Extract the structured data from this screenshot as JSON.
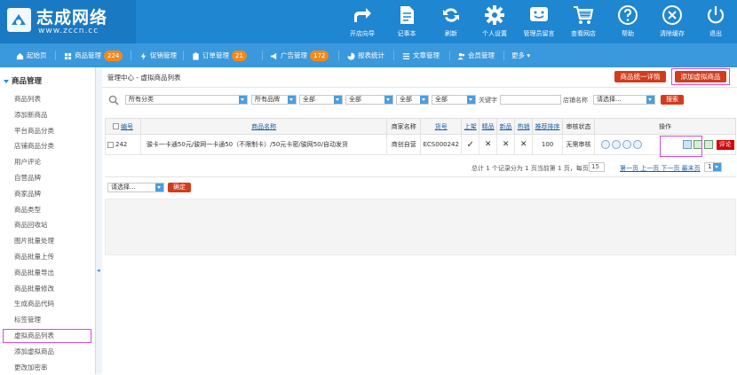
{
  "brand": {
    "name": "志成网络",
    "url": "www.zccn.cc"
  },
  "toolbar": [
    {
      "label": "开店向导",
      "icon": "share-arrow-icon"
    },
    {
      "label": "记事本",
      "icon": "notepad-icon"
    },
    {
      "label": "刷新",
      "icon": "refresh-icon"
    },
    {
      "label": "个人设置",
      "icon": "gear-icon"
    },
    {
      "label": "管理员留言",
      "icon": "smiley-message-icon"
    },
    {
      "label": "查看网店",
      "icon": "shopping-cart-icon"
    },
    {
      "label": "帮助",
      "icon": "help-icon"
    },
    {
      "label": "清除缓存",
      "icon": "clear-cache-icon"
    },
    {
      "label": "退出",
      "icon": "power-icon"
    }
  ],
  "nav": [
    {
      "label": "起始页",
      "badge": ""
    },
    {
      "label": "商品管理",
      "badge": "224"
    },
    {
      "label": "促销管理",
      "badge": ""
    },
    {
      "label": "订单管理",
      "badge": "21"
    },
    {
      "label": "广告管理",
      "badge": "172"
    },
    {
      "label": "报表统计",
      "badge": ""
    },
    {
      "label": "文章管理",
      "badge": ""
    },
    {
      "label": "会员管理",
      "badge": ""
    },
    {
      "label": "更多 ▾",
      "badge": ""
    }
  ],
  "sidebar": {
    "group": "商品管理",
    "items": [
      "商品列表",
      "添加新商品",
      "平台商品分类",
      "店铺商品分类",
      "用户评论",
      "自营品牌",
      "商家品牌",
      "商品类型",
      "商品回收站",
      "图片批量处理",
      "商品批量上传",
      "商品批量导出",
      "商品批量修改",
      "生成商品代码",
      "标签管理",
      "虚拟商品列表",
      "添加虚拟商品",
      "更改加密串"
    ],
    "active_index": 15
  },
  "breadcrumb": "管理中心 - 虚拟商品列表",
  "actions": {
    "unify_label": "商品统一详情",
    "add_label": "添加虚拟商品"
  },
  "filters": {
    "category": "所有分类",
    "brand": "所有品牌",
    "f3": "全部",
    "f4": "全部",
    "f5": "全部",
    "f6": "全部",
    "keyword_label": "关键字",
    "shop_label": "店铺名称",
    "shop_select": "请选择...",
    "search_label": "搜索"
  },
  "table": {
    "headers": [
      "编号",
      "商品名称",
      "商家名称",
      "货号",
      "上架",
      "精品",
      "新品",
      "热销",
      "推荐排序",
      "审核状态",
      "操作"
    ],
    "rows": [
      {
        "id": "242",
        "name": "骏卡一卡通50元/骏网一卡通50（不限制卡）/50元卡密/骏网50/自动发货",
        "shop": "商创自营",
        "sn": "ECS000242",
        "on_sale": "✓",
        "best": "✕",
        "new": "✕",
        "hot": "✕",
        "sort": "100",
        "audit": "无需审核",
        "comment_label": "评论"
      }
    ]
  },
  "pager": {
    "summary": "总计 1 个记录分为 1 页当前第 1 页，每页",
    "per_page": "15",
    "links": "第一页 上一页 下一页 最末页",
    "page_select": "1"
  },
  "batch": {
    "select": "请选择...",
    "confirm_label": "确定"
  },
  "colors": {
    "header": "#1f86d2",
    "nav": "#3a99dc",
    "accent_red": "#d33c1b",
    "highlight": "#d849d8"
  }
}
